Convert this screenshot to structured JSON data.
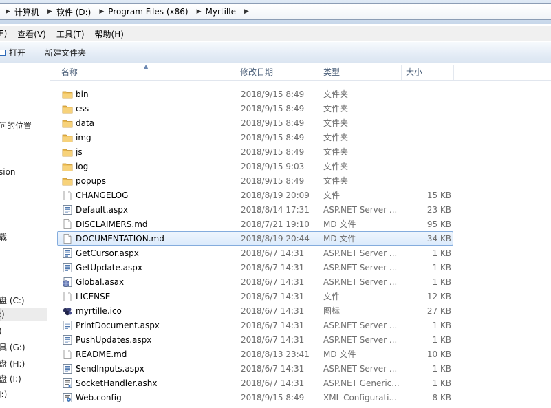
{
  "address": {
    "crumbs": [
      {
        "label": "计算机"
      },
      {
        "label": "软件 (D:)"
      },
      {
        "label": "Program Files (x86)"
      },
      {
        "label": "Myrtille"
      }
    ]
  },
  "menu": {
    "items": [
      {
        "label": "E)"
      },
      {
        "label": "查看(V)"
      },
      {
        "label": "工具(T)"
      },
      {
        "label": "帮助(H)"
      }
    ]
  },
  "toolbar": {
    "open_label": "打开",
    "new_folder_label": "新建文件夹"
  },
  "nav": {
    "items": [
      {
        "label": "问的位置"
      },
      {
        "label": "sion"
      },
      {
        "label": "载"
      },
      {
        "label": "盘 (C:)"
      },
      {
        "label": ":)"
      },
      {
        "label": ")"
      },
      {
        "label": "具 (G:)"
      },
      {
        "label": "盘 (H:)"
      },
      {
        "label": "盘 (I:)"
      },
      {
        "label": "J:)"
      }
    ]
  },
  "columns": {
    "name": "名称",
    "date": "修改日期",
    "type": "类型",
    "size": "大小"
  },
  "files": [
    {
      "name": "bin",
      "date": "2018/9/15 8:49",
      "type": "文件夹",
      "size": "",
      "icon": "folder-icon"
    },
    {
      "name": "css",
      "date": "2018/9/15 8:49",
      "type": "文件夹",
      "size": "",
      "icon": "folder-icon"
    },
    {
      "name": "data",
      "date": "2018/9/15 8:49",
      "type": "文件夹",
      "size": "",
      "icon": "folder-icon"
    },
    {
      "name": "img",
      "date": "2018/9/15 8:49",
      "type": "文件夹",
      "size": "",
      "icon": "folder-icon"
    },
    {
      "name": "js",
      "date": "2018/9/15 8:49",
      "type": "文件夹",
      "size": "",
      "icon": "folder-icon"
    },
    {
      "name": "log",
      "date": "2018/9/15 9:03",
      "type": "文件夹",
      "size": "",
      "icon": "folder-icon"
    },
    {
      "name": "popups",
      "date": "2018/9/15 8:49",
      "type": "文件夹",
      "size": "",
      "icon": "folder-icon"
    },
    {
      "name": "CHANGELOG",
      "date": "2018/8/19 20:09",
      "type": "文件",
      "size": "15 KB",
      "icon": "file-icon"
    },
    {
      "name": "Default.aspx",
      "date": "2018/8/14 17:31",
      "type": "ASP.NET Server ...",
      "size": "23 KB",
      "icon": "aspx-file-icon"
    },
    {
      "name": "DISCLAIMERS.md",
      "date": "2018/7/21 19:10",
      "type": "MD 文件",
      "size": "95 KB",
      "icon": "file-icon"
    },
    {
      "name": "DOCUMENTATION.md",
      "date": "2018/8/19 20:44",
      "type": "MD 文件",
      "size": "34 KB",
      "icon": "file-icon",
      "selected": true
    },
    {
      "name": "GetCursor.aspx",
      "date": "2018/6/7 14:31",
      "type": "ASP.NET Server ...",
      "size": "1 KB",
      "icon": "aspx-file-icon"
    },
    {
      "name": "GetUpdate.aspx",
      "date": "2018/6/7 14:31",
      "type": "ASP.NET Server ...",
      "size": "1 KB",
      "icon": "aspx-file-icon"
    },
    {
      "name": "Global.asax",
      "date": "2018/6/7 14:31",
      "type": "ASP.NET Server ...",
      "size": "1 KB",
      "icon": "asax-file-icon"
    },
    {
      "name": "LICENSE",
      "date": "2018/6/7 14:31",
      "type": "文件",
      "size": "12 KB",
      "icon": "file-icon"
    },
    {
      "name": "myrtille.ico",
      "date": "2018/6/7 14:31",
      "type": "图标",
      "size": "27 KB",
      "icon": "ico-file-icon"
    },
    {
      "name": "PrintDocument.aspx",
      "date": "2018/6/7 14:31",
      "type": "ASP.NET Server ...",
      "size": "1 KB",
      "icon": "aspx-file-icon"
    },
    {
      "name": "PushUpdates.aspx",
      "date": "2018/6/7 14:31",
      "type": "ASP.NET Server ...",
      "size": "1 KB",
      "icon": "aspx-file-icon"
    },
    {
      "name": "README.md",
      "date": "2018/8/13 23:41",
      "type": "MD 文件",
      "size": "10 KB",
      "icon": "file-icon"
    },
    {
      "name": "SendInputs.aspx",
      "date": "2018/6/7 14:31",
      "type": "ASP.NET Server ...",
      "size": "1 KB",
      "icon": "aspx-file-icon"
    },
    {
      "name": "SocketHandler.ashx",
      "date": "2018/6/7 14:31",
      "type": "ASP.NET Generic...",
      "size": "1 KB",
      "icon": "ashx-file-icon"
    },
    {
      "name": "Web.config",
      "date": "2018/9/15 8:49",
      "type": "XML Configurati...",
      "size": "8 KB",
      "icon": "config-file-icon"
    }
  ]
}
